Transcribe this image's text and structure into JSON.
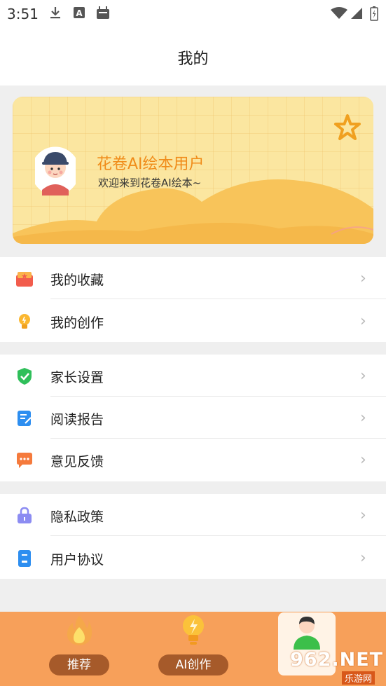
{
  "status_bar": {
    "time": "3:51"
  },
  "header": {
    "title": "我的"
  },
  "profile": {
    "username": "花卷AI绘本用户",
    "welcome": "欢迎来到花卷AI绘本~"
  },
  "menu": {
    "group1": [
      {
        "label": "我的收藏",
        "icon": "favorites-icon"
      },
      {
        "label": "我的创作",
        "icon": "lightbulb-icon"
      }
    ],
    "group2": [
      {
        "label": "家长设置",
        "icon": "shield-check-icon"
      },
      {
        "label": "阅读报告",
        "icon": "report-icon"
      },
      {
        "label": "意见反馈",
        "icon": "feedback-icon"
      }
    ],
    "group3": [
      {
        "label": "隐私政策",
        "icon": "lock-icon"
      },
      {
        "label": "用户协议",
        "icon": "agreement-icon"
      }
    ],
    "chevron": "›"
  },
  "tabbar": {
    "tabs": [
      {
        "label": "推荐",
        "icon": "flame-icon"
      },
      {
        "label": "AI创作",
        "icon": "lightbulb-icon"
      },
      {
        "label": "",
        "icon": "profile-avatar-icon"
      }
    ],
    "active_index": 2
  },
  "watermark": {
    "line1": "962.NET",
    "line2": "乐游网"
  },
  "colors": {
    "accent": "#f08c1a",
    "tabbar_bg": "#f7a05a",
    "pill_bg": "#a65a2a",
    "banner_bg": "#fbe6a0"
  }
}
